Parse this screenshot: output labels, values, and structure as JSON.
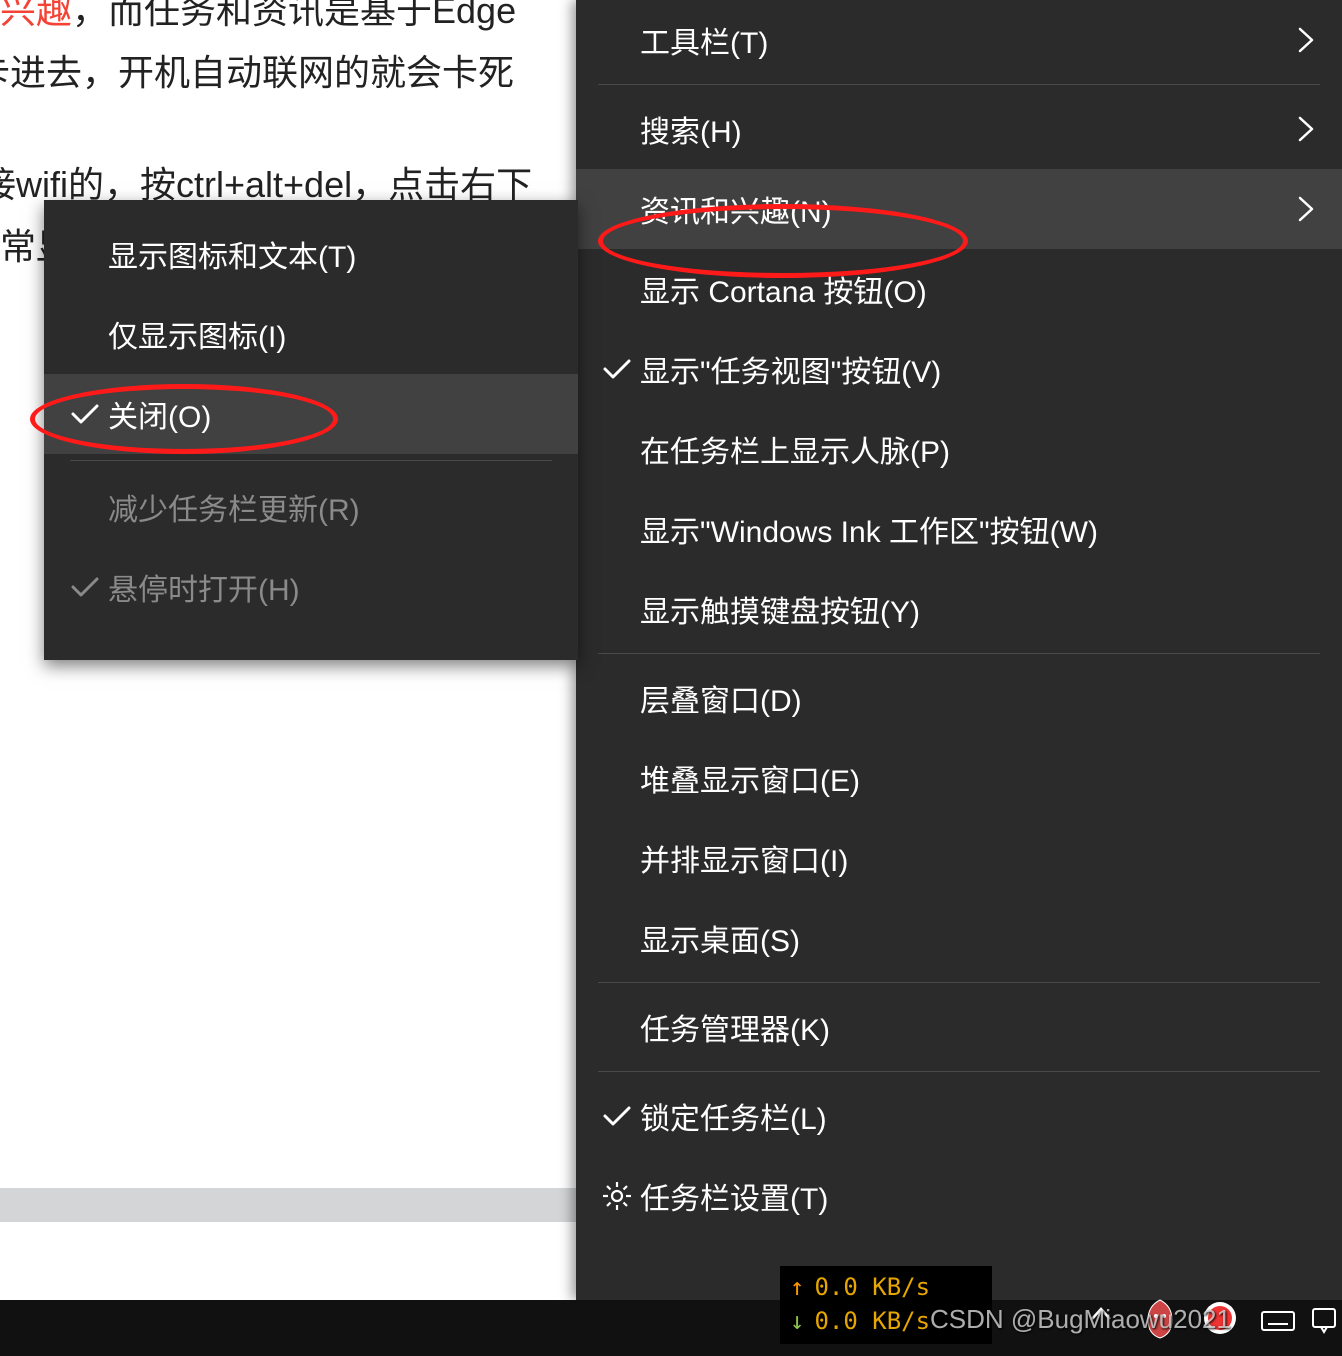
{
  "background": {
    "frag_red": "兴趣",
    "line1_a": "，而任务和资讯是基于Edge",
    "line2": "卡进去，开机自动联网的就会卡死",
    "line3_a": "接wifi的，按ctrl+alt+del，点击右下",
    "line3_b": "常显"
  },
  "main_menu": {
    "toolbars": "工具栏(T)",
    "search": "搜索(H)",
    "news": "资讯和兴趣(N)",
    "cortana": "显示 Cortana 按钮(O)",
    "task_view": "显示\"任务视图\"按钮(V)",
    "people": "在任务栏上显示人脉(P)",
    "ink": "显示\"Windows Ink 工作区\"按钮(W)",
    "touch_kb": "显示触摸键盘按钮(Y)",
    "cascade": "层叠窗口(D)",
    "stacked": "堆叠显示窗口(E)",
    "side": "并排显示窗口(I)",
    "desktop": "显示桌面(S)",
    "taskmgr": "任务管理器(K)",
    "lock": "锁定任务栏(L)",
    "settings": "任务栏设置(T)"
  },
  "sub_menu": {
    "icon_text": "显示图标和文本(T)",
    "icon_only": "仅显示图标(I)",
    "close": "关闭(O)",
    "reduce": "减少任务栏更新(R)",
    "hover": "悬停时打开(H)"
  },
  "netwidget": {
    "up": "0.0 KB/s",
    "down": "0.0 KB/s"
  },
  "watermark": "CSDN @BugMiaowu2021",
  "icons": {
    "chevron": "chevron-right-icon",
    "check": "check-icon",
    "gear": "gear-icon",
    "arrow_up": "arrow-up-icon",
    "arrow_down": "arrow-down-icon"
  }
}
